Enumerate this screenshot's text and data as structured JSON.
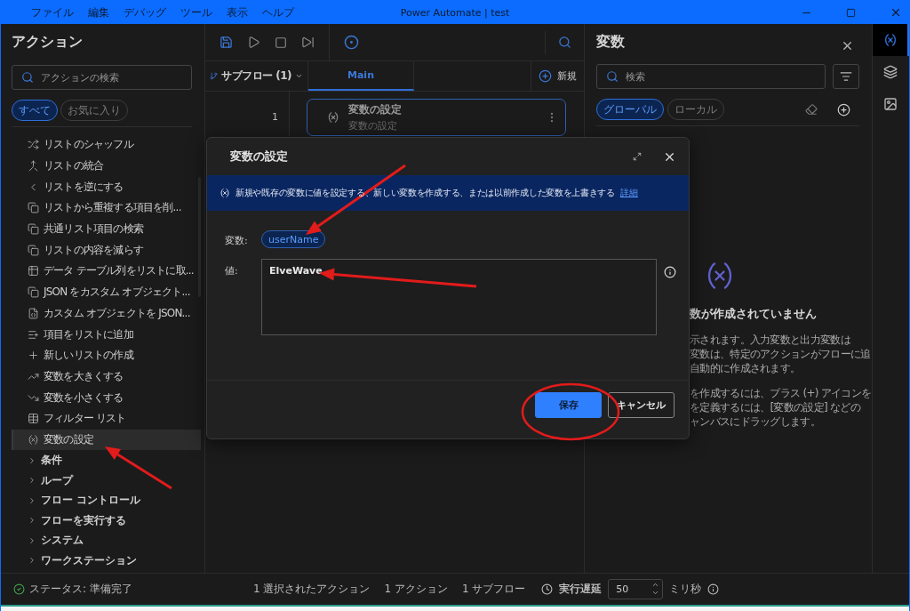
{
  "window": {
    "title": "Power Automate | test",
    "menu": [
      "ファイル",
      "編集",
      "デバッグ",
      "ツール",
      "表示",
      "ヘルプ"
    ]
  },
  "actions_panel": {
    "title": "アクション",
    "search": {
      "placeholder": "アクションの検索"
    },
    "filters": [
      {
        "label": "すべて",
        "selected": true
      },
      {
        "label": "お気に入り",
        "selected": false
      }
    ],
    "items": [
      {
        "label": "リストのシャッフル",
        "selected": false
      },
      {
        "label": "リストの統合",
        "selected": false
      },
      {
        "label": "リストを逆にする",
        "selected": false
      },
      {
        "label": "リストから重複する項目を削...",
        "selected": false
      },
      {
        "label": "共通リスト項目の検索",
        "selected": false
      },
      {
        "label": "リストの内容を減らす",
        "selected": false
      },
      {
        "label": "データ テーブル列をリストに取...",
        "selected": false
      },
      {
        "label": "JSON をカスタム オブジェクト...",
        "selected": false
      },
      {
        "label": "カスタム オブジェクトを JSON...",
        "selected": false
      },
      {
        "label": "項目をリストに追加",
        "selected": false
      },
      {
        "label": "新しいリストの作成",
        "selected": false
      },
      {
        "label": "変数を大きくする",
        "selected": false
      },
      {
        "label": "変数を小さくする",
        "selected": false
      },
      {
        "label": "フィルター リスト",
        "selected": false
      },
      {
        "label": "変数の設定",
        "selected": true
      }
    ],
    "groups": [
      {
        "label": "条件",
        "expanded": false
      },
      {
        "label": "ループ",
        "expanded": false
      },
      {
        "label": "フロー コントロール",
        "expanded": false
      },
      {
        "label": "フローを実行する",
        "expanded": false
      },
      {
        "label": "システム",
        "expanded": false
      },
      {
        "label": "ワークステーション",
        "expanded": false
      }
    ]
  },
  "flow_editor": {
    "subflows": "サブフロー (1)",
    "tabs": [
      {
        "label": "Main",
        "selected": true
      }
    ],
    "new_button": "新規",
    "steps": [
      {
        "number": "1",
        "title": "変数の設定",
        "subtitle": "変数の設定",
        "selected": true
      }
    ]
  },
  "variables_panel": {
    "title": "変数",
    "search": {
      "placeholder": "検索"
    },
    "scopes": [
      {
        "label": "グローバル",
        "selected": true
      },
      {
        "label": "ローカル",
        "selected": false
      }
    ],
    "empty_heading": "数が作成されていません",
    "empty_paragraphs": [
      [
        "示されます。入力変数と出力変数は",
        "変数は、特定のアクションがフローに追",
        "自動的に作成されます。"
      ],
      [
        "を作成するには、プラス (+) アイコンを",
        "を定義するには、[変数の設定] などの",
        "ャンバスにドラッグします。"
      ]
    ]
  },
  "side_tabs": [
    {
      "selected": true
    },
    {
      "selected": false
    },
    {
      "selected": false
    }
  ],
  "dialog": {
    "title": "変数の設定",
    "description": "新規や既存の変数に値を設定する、新しい変数を作成する、または以前作成した変数を上書きする",
    "link": "詳細",
    "fields": [
      {
        "label": "変数:",
        "kind": "chip",
        "value": "userName"
      },
      {
        "label": "値:",
        "kind": "textarea",
        "value": "ElveWave"
      }
    ],
    "buttons": [
      {
        "label": "保存",
        "primary": true
      },
      {
        "label": "キャンセル",
        "primary": false
      }
    ]
  },
  "status_bar": {
    "status": "ステータス: 準備完了",
    "counts": [
      "1 選択されたアクション",
      "1 アクション",
      "1 サブフロー"
    ],
    "delay_label": "実行遅延",
    "delay": "50",
    "unit": "ミリ秒"
  }
}
